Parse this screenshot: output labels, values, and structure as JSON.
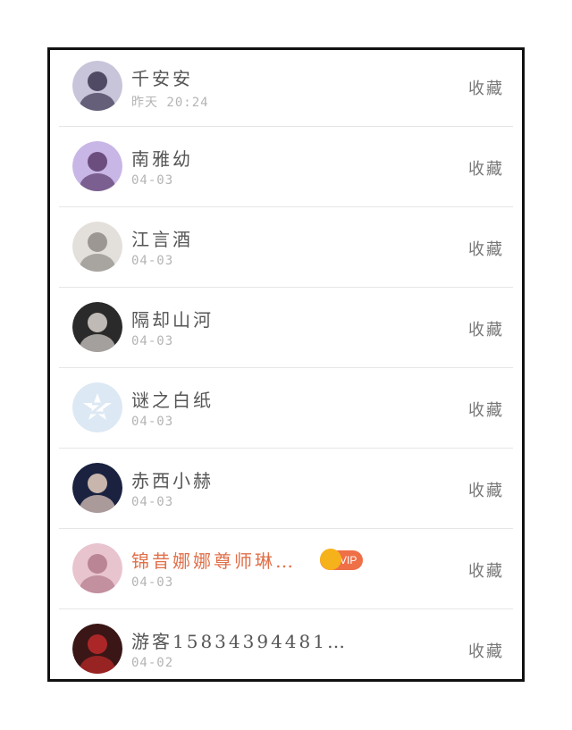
{
  "favorite_label": "收藏",
  "users": [
    {
      "name": "千安安",
      "time": "昨天 20:24",
      "vip": false,
      "avatar_icon": "girl-portrait-avatar",
      "avatar_colors": [
        "#c8c4d9",
        "#3b3550"
      ]
    },
    {
      "name": "南雅幼",
      "time": "04-03",
      "vip": false,
      "avatar_icon": "purple-sky-girl-avatar",
      "avatar_colors": [
        "#c8b6e6",
        "#5a3b6b"
      ]
    },
    {
      "name": "江言酒",
      "time": "04-03",
      "vip": false,
      "avatar_icon": "white-dress-avatar",
      "avatar_colors": [
        "#e3e0dc",
        "#8f8a86"
      ]
    },
    {
      "name": "隔却山河",
      "time": "04-03",
      "vip": false,
      "avatar_icon": "boy-portrait-avatar",
      "avatar_colors": [
        "#2a2a2a",
        "#d9d3ce"
      ]
    },
    {
      "name": "谜之白纸",
      "time": "04-03",
      "vip": false,
      "avatar_icon": "default-qzone-avatar",
      "avatar_colors": [
        "#dce8f3",
        "#ffffff"
      ]
    },
    {
      "name": "赤西小赫",
      "time": "04-03",
      "vip": false,
      "avatar_icon": "boy-face-avatar",
      "avatar_colors": [
        "#1a2240",
        "#e8cfc0"
      ]
    },
    {
      "name": "锦昔娜娜尊师琳…",
      "time": "04-03",
      "vip": true,
      "vip_label": "VIP",
      "avatar_icon": "pink-portrait-avatar",
      "avatar_colors": [
        "#e8c4cf",
        "#b27a8a"
      ]
    },
    {
      "name": "游客15834394481…",
      "time": "04-02",
      "vip": false,
      "avatar_icon": "red-hood-avatar",
      "avatar_colors": [
        "#3a1616",
        "#c02a2a"
      ]
    }
  ],
  "colors": {
    "name_text": "#555555",
    "vip_name_text": "#e0704a",
    "time_text": "#b4b4b4",
    "vip_badge": "#ef6f47",
    "divider": "#e6e6e6"
  }
}
